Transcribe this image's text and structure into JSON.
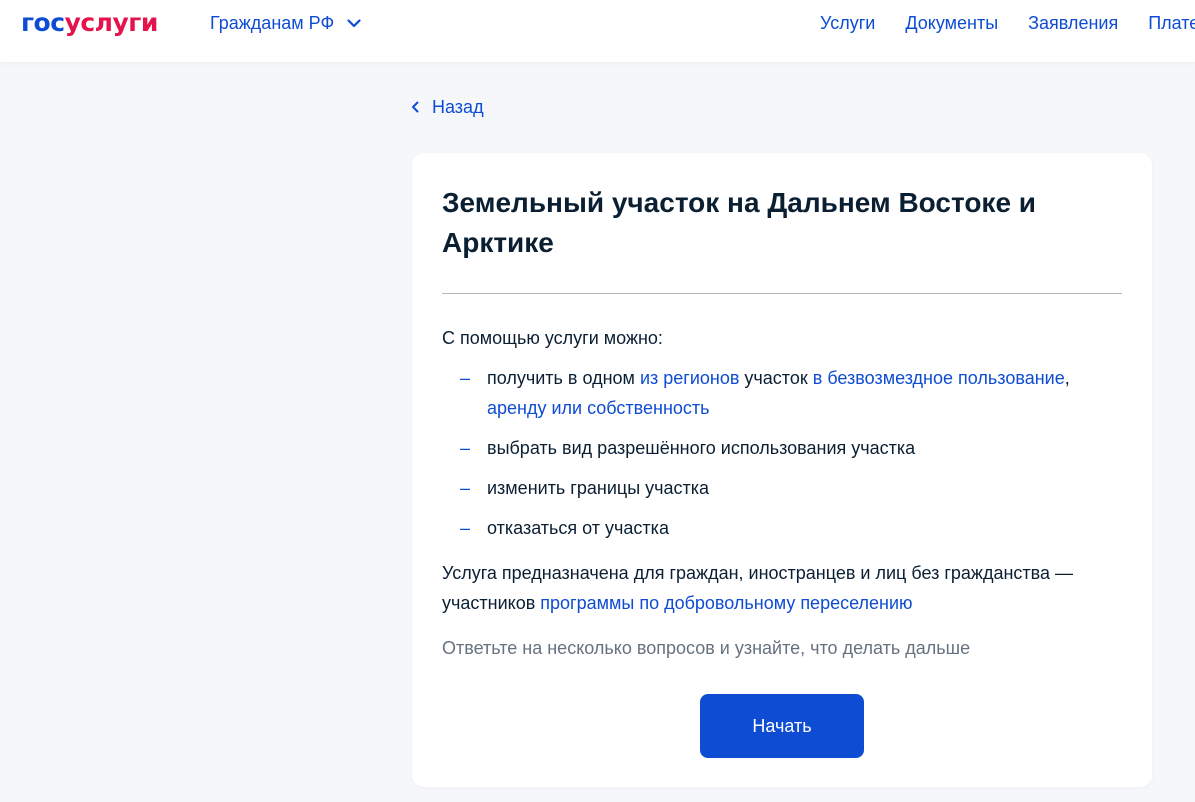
{
  "colors": {
    "accent": "#0d4cd3",
    "brand_red": "#e5134b",
    "text": "#0b1f33",
    "muted": "#66727f",
    "background": "#f5f7fa"
  },
  "header": {
    "logo_part1": "гос",
    "logo_part2": "услуги",
    "region_label": "Гражданам РФ",
    "nav": [
      "Услуги",
      "Документы",
      "Заявления",
      "Платежи"
    ]
  },
  "back_label": "Назад",
  "card": {
    "title": "Земельный участок на Дальнем Востоке и Арктике",
    "intro": "С помощью услуги можно:",
    "item1": {
      "t1": "получить в одном ",
      "link1": "из регионов",
      "t2": " участок ",
      "link2": "в безвозмездное пользование",
      "t3": ", ",
      "link3": "аренду или собственность"
    },
    "items": [
      "выбрать вид разрешённого использования участка",
      "изменить границы участка",
      "отказаться от участка"
    ],
    "purpose_text": "Услуга предназначена для граждан, иностранцев и лиц без гражданства — участников ",
    "purpose_link": "программы по добровольному переселению",
    "hint": "Ответьте на несколько вопросов и узнайте, что делать дальше",
    "start_button": "Начать"
  }
}
